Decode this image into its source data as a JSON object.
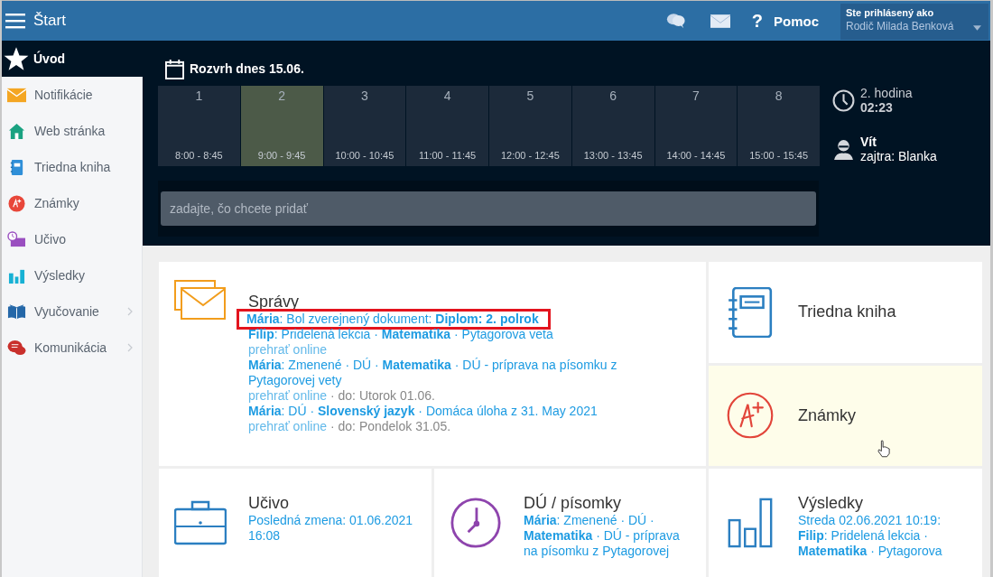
{
  "topbar": {
    "menu_title": "Štart",
    "help_glyph": "?",
    "help_label": "Pomoc",
    "user_caption": "Ste prihlásený ako",
    "user_name": "Rodič Milada Benková"
  },
  "sidebar": {
    "items": [
      {
        "label": "Úvod",
        "kind": "star",
        "selected": true,
        "has_submenu": false
      },
      {
        "label": "Notifikácie",
        "kind": "envelope",
        "selected": false,
        "has_submenu": false
      },
      {
        "label": "Web stránka",
        "kind": "house",
        "selected": false,
        "has_submenu": false
      },
      {
        "label": "Triedna kniha",
        "kind": "notebook",
        "selected": false,
        "has_submenu": false
      },
      {
        "label": "Známky",
        "kind": "grade",
        "selected": false,
        "has_submenu": false
      },
      {
        "label": "Učivo",
        "kind": "lesson",
        "selected": false,
        "has_submenu": false
      },
      {
        "label": "Výsledky",
        "kind": "bars",
        "selected": false,
        "has_submenu": false
      },
      {
        "label": "Vyučovanie",
        "kind": "book",
        "selected": false,
        "has_submenu": true
      },
      {
        "label": "Komunikácia",
        "kind": "chat",
        "selected": false,
        "has_submenu": true
      }
    ]
  },
  "schedule": {
    "title": "Rozvrh dnes 15.06.",
    "periods": [
      {
        "number": "1",
        "time": "8:00 - 8:45",
        "current": false
      },
      {
        "number": "2",
        "time": "9:00 - 9:45",
        "current": true
      },
      {
        "number": "3",
        "time": "10:00 - 10:45",
        "current": false
      },
      {
        "number": "4",
        "time": "11:00 - 11:45",
        "current": false
      },
      {
        "number": "5",
        "time": "12:00 - 12:45",
        "current": false
      },
      {
        "number": "6",
        "time": "13:00 - 13:45",
        "current": false
      },
      {
        "number": "7",
        "time": "14:00 - 14:45",
        "current": false
      },
      {
        "number": "8",
        "time": "15:00 - 15:45",
        "current": false
      }
    ],
    "input_placeholder": "zadajte, čo chcete pridať"
  },
  "status": {
    "period": "2. hodina",
    "remaining": "02:23",
    "child": "Vít",
    "tomorrow": "zajtra: Blanka"
  },
  "messages": {
    "title": "Správy",
    "items": [
      {
        "text": "**Mária**: Bol zverejnený dokument: **Diplom: 2. polrok**",
        "highlighted": true
      },
      {
        "text": "**Filip**: Pridelená lekcia · **Matematika** · Pytagorova veta",
        "link": "prehrať online",
        "highlighted": false
      },
      {
        "text": "**Mária**: Zmenené · DÚ · **Matematika** · DÚ - príprava na písomku z Pytagorovej vety",
        "link": "prehrať online",
        "note": "· do: Utorok 01.06.",
        "highlighted": false
      },
      {
        "text": "**Mária**: DÚ · **Slovenský jazyk** · Domáca úloha z 31. May 2021",
        "link": "prehrať online",
        "note": "· do: Pondelok 31.05.",
        "highlighted": false
      }
    ]
  },
  "shortcuts": [
    {
      "label": "Triedna kniha",
      "kind": "notebook",
      "hovered": false
    },
    {
      "label": "Známky",
      "kind": "grade",
      "hovered": true
    }
  ],
  "bottom_tiles": [
    {
      "title": "Učivo",
      "kind": "briefcase",
      "text": "Posledná zmena: 01.06.2021 16:08"
    },
    {
      "title": "DÚ / písomky",
      "kind": "clock",
      "text": "**Mária**: Zmenené · DÚ · **Matematika** · DÚ - príprava na písomku z Pytagorovej"
    },
    {
      "title": "Výsledky",
      "kind": "bars",
      "text": "Streda 02.06.2021 10:19: **Filip**: Pridelená lekcia · **Matematika** · Pytagorova"
    }
  ]
}
